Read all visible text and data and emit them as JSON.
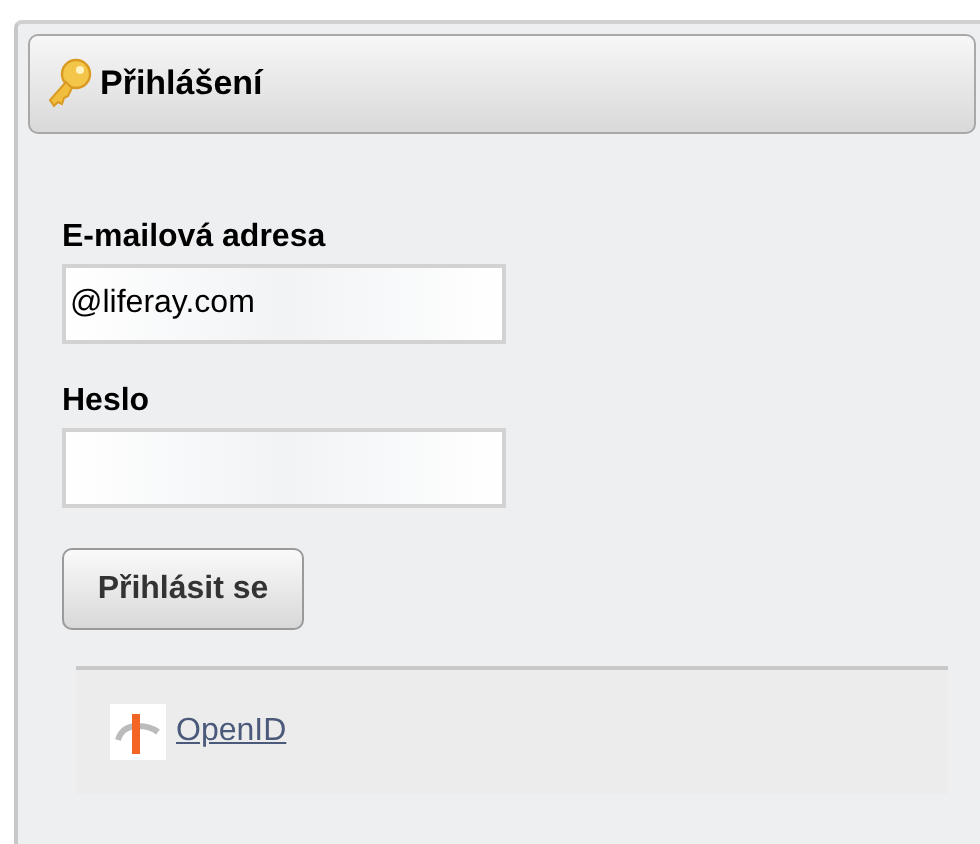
{
  "portlet": {
    "title": "Přihlášení"
  },
  "fields": [
    {
      "label": "E-mailová adresa",
      "value": "@liferay.com"
    },
    {
      "label": "Heslo"
    }
  ],
  "buttons": [
    "Přihlásit se"
  ],
  "links": [
    "OpenID"
  ]
}
